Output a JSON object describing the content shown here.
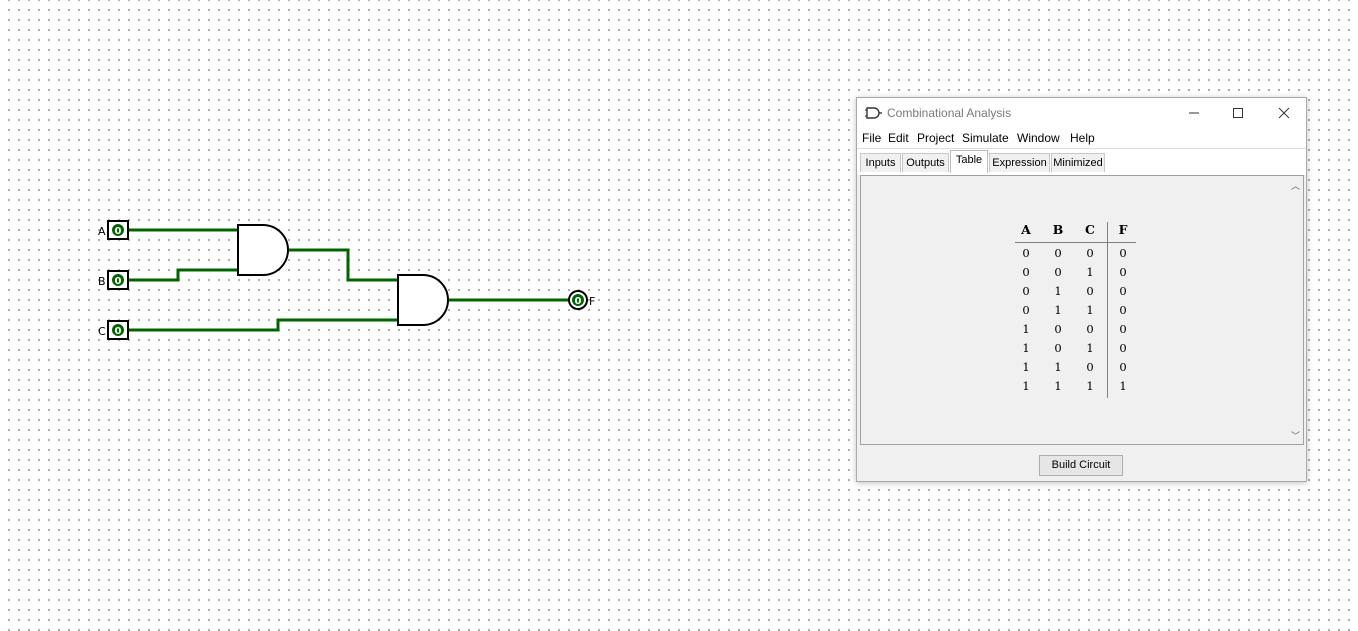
{
  "circuit": {
    "inputs": [
      {
        "label": "A",
        "value": "0"
      },
      {
        "label": "B",
        "value": "0"
      },
      {
        "label": "C",
        "value": "0"
      }
    ],
    "output": {
      "label": "F",
      "value": "0"
    },
    "wire_color": "#006400"
  },
  "window": {
    "title": "Combinational Analysis",
    "controls": [
      "minimize-icon",
      "maximize-icon",
      "close-icon"
    ]
  },
  "menu": [
    "File",
    "Edit",
    "Project",
    "Simulate",
    "Window",
    "Help"
  ],
  "tabs": {
    "items": [
      "Inputs",
      "Outputs",
      "Table",
      "Expression",
      "Minimized"
    ],
    "active": "Table"
  },
  "truth_table": {
    "headers": [
      "A",
      "B",
      "C",
      "F"
    ],
    "rows": [
      [
        "0",
        "0",
        "0",
        "0"
      ],
      [
        "0",
        "0",
        "1",
        "0"
      ],
      [
        "0",
        "1",
        "0",
        "0"
      ],
      [
        "0",
        "1",
        "1",
        "0"
      ],
      [
        "1",
        "0",
        "0",
        "0"
      ],
      [
        "1",
        "0",
        "1",
        "0"
      ],
      [
        "1",
        "1",
        "0",
        "0"
      ],
      [
        "1",
        "1",
        "1",
        "1"
      ]
    ]
  },
  "build_button": "Build Circuit"
}
